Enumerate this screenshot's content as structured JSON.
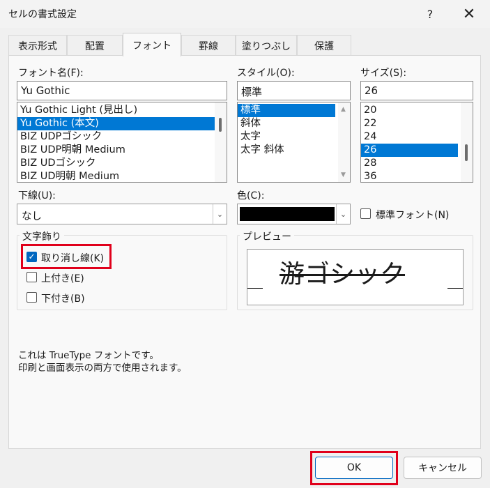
{
  "window": {
    "title": "セルの書式設定",
    "help": "?",
    "close": "✕"
  },
  "tabs": [
    "表示形式",
    "配置",
    "フォント",
    "罫線",
    "塗りつぶし",
    "保護"
  ],
  "font_name": {
    "label": "フォント名(F):",
    "value": "Yu Gothic",
    "options": [
      "Yu Gothic Light (見出し)",
      "Yu Gothic (本文)",
      "BIZ UDPゴシック",
      "BIZ UDP明朝 Medium",
      "BIZ UDゴシック",
      "BIZ UD明朝 Medium"
    ],
    "selected": "Yu Gothic (本文)"
  },
  "style": {
    "label": "スタイル(O):",
    "value": "標準",
    "options": [
      "標準",
      "斜体",
      "太字",
      "太字 斜体"
    ],
    "selected": "標準"
  },
  "size": {
    "label": "サイズ(S):",
    "value": "26",
    "options": [
      "20",
      "22",
      "24",
      "26",
      "28",
      "36"
    ],
    "selected": "26"
  },
  "underline": {
    "label": "下線(U):",
    "value": "なし"
  },
  "color": {
    "label": "色(C):",
    "value_hex": "#000000",
    "normal_font_label": "標準フォント(N)",
    "normal_font_checked": false
  },
  "effects": {
    "title": "文字飾り",
    "strikethrough": {
      "label": "取り消し線(K)",
      "checked": true
    },
    "superscript": {
      "label": "上付き(E)",
      "checked": false
    },
    "subscript": {
      "label": "下付き(B)",
      "checked": false
    }
  },
  "preview": {
    "title": "プレビュー",
    "sample_text": "游ゴシック"
  },
  "info": {
    "line1": "これは TrueType フォントです。",
    "line2": "印刷と画面表示の両方で使用されます。"
  },
  "buttons": {
    "ok": "OK",
    "cancel": "キャンセル"
  },
  "colors": {
    "accent": "#0078d4",
    "highlight": "#e0001b"
  }
}
